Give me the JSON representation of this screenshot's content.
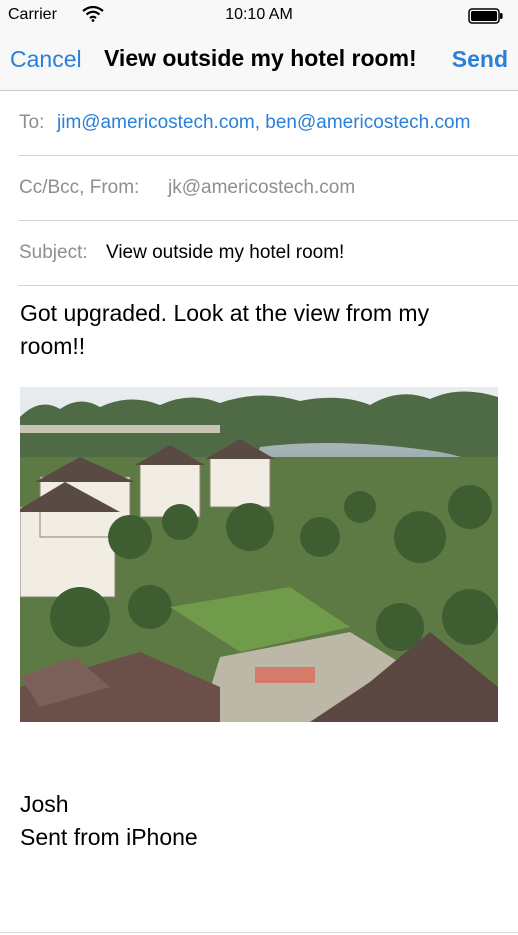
{
  "status_bar": {
    "carrier": "Carrier",
    "time": "10:10 AM",
    "wifi_icon": "wifi-icon",
    "battery_icon": "battery-icon"
  },
  "nav": {
    "cancel_label": "Cancel",
    "title": "View outside my hotel room!",
    "send_label": "Send",
    "accent_color": "#2a7fd8"
  },
  "fields": {
    "to_label": "To:",
    "to_value": "jim@americostech.com, ben@americostech.com",
    "ccbcc_label": "Cc/Bcc, From:",
    "from_value": "jk@americostech.com",
    "subject_label": "Subject:",
    "subject_value": "View outside my hotel room!"
  },
  "body": {
    "message": "Got upgraded. Look at the view from my room!!",
    "attachment": "hotel-view-photo",
    "signature_name": "Josh",
    "signature_sent": "Sent from iPhone"
  }
}
